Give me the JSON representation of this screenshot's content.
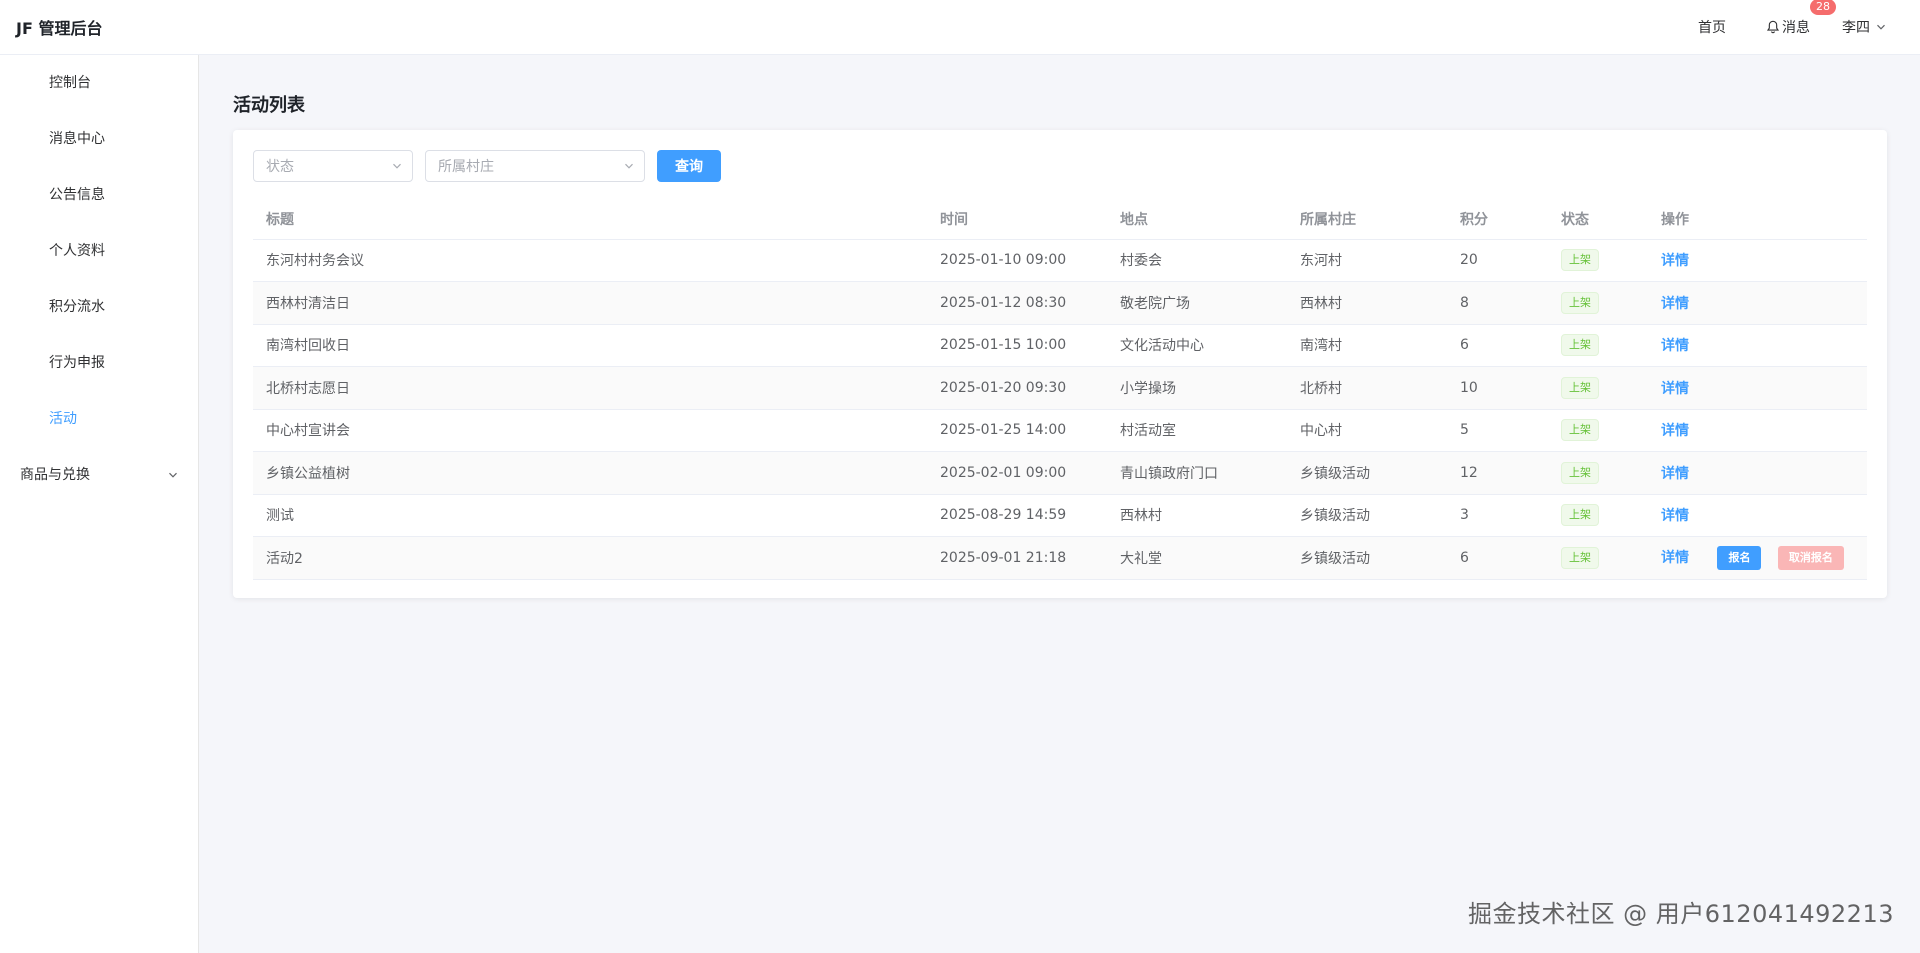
{
  "header": {
    "brand": "JF 管理后台",
    "home_label": "首页",
    "messages_label": "消息",
    "messages_badge": "28",
    "user_name": "李四"
  },
  "sidebar": {
    "items": [
      {
        "label": "控制台"
      },
      {
        "label": "消息中心"
      },
      {
        "label": "公告信息"
      },
      {
        "label": "个人资料"
      },
      {
        "label": "积分流水"
      },
      {
        "label": "行为申报"
      },
      {
        "label": "活动"
      }
    ],
    "active_index": 6,
    "group": {
      "label": "商品与兑换"
    }
  },
  "main": {
    "title": "活动列表",
    "filters": {
      "status_placeholder": "状态",
      "village_placeholder": "所属村庄",
      "query_label": "查询"
    },
    "table": {
      "columns": [
        "标题",
        "时间",
        "地点",
        "所属村庄",
        "积分",
        "状态",
        "操作"
      ],
      "rows": [
        {
          "title": "东河村村务会议",
          "time": "2025-01-10 09:00",
          "place": "村委会",
          "village": "东河村",
          "points": "20",
          "status": "上架",
          "action": "详情"
        },
        {
          "title": "西林村清洁日",
          "time": "2025-01-12 08:30",
          "place": "敬老院广场",
          "village": "西林村",
          "points": "8",
          "status": "上架",
          "action": "详情"
        },
        {
          "title": "南湾村回收日",
          "time": "2025-01-15 10:00",
          "place": "文化活动中心",
          "village": "南湾村",
          "points": "6",
          "status": "上架",
          "action": "详情"
        },
        {
          "title": "北桥村志愿日",
          "time": "2025-01-20 09:30",
          "place": "小学操场",
          "village": "北桥村",
          "points": "10",
          "status": "上架",
          "action": "详情"
        },
        {
          "title": "中心村宣讲会",
          "time": "2025-01-25 14:00",
          "place": "村活动室",
          "village": "中心村",
          "points": "5",
          "status": "上架",
          "action": "详情"
        },
        {
          "title": "乡镇公益植树",
          "time": "2025-02-01 09:00",
          "place": "青山镇政府门口",
          "village": "乡镇级活动",
          "points": "12",
          "status": "上架",
          "action": "详情"
        },
        {
          "title": "测试",
          "time": "2025-08-29 14:59",
          "place": "西林村",
          "village": "乡镇级活动",
          "points": "3",
          "status": "上架",
          "action": "详情"
        },
        {
          "title": "活动2",
          "time": "2025-09-01 21:18",
          "place": "大礼堂",
          "village": "乡镇级活动",
          "points": "6",
          "status": "上架",
          "action": "详情",
          "signup": "报名",
          "cancel": "取消报名"
        }
      ]
    }
  },
  "watermark": "掘金技术社区 @ 用户612041492213",
  "colors": {
    "primary": "#409eff",
    "success": "#67c23a",
    "danger_light": "#fab6b6",
    "badge": "#f56c6c"
  }
}
